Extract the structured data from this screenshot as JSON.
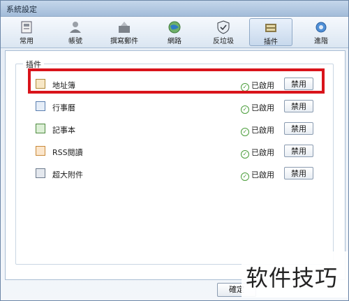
{
  "window": {
    "title": "系統設定"
  },
  "toolbar": {
    "items": [
      {
        "label": "常用",
        "icon": "settings-panel-icon",
        "active": false
      },
      {
        "label": "帳號",
        "icon": "user-icon",
        "active": false
      },
      {
        "label": "撰寫郵件",
        "icon": "compose-icon",
        "active": false
      },
      {
        "label": "網路",
        "icon": "globe-icon",
        "active": false
      },
      {
        "label": "反垃圾",
        "icon": "shield-icon",
        "active": false
      },
      {
        "label": "插件",
        "icon": "plugin-icon",
        "active": true
      },
      {
        "label": "進階",
        "icon": "gear-icon",
        "active": false
      }
    ]
  },
  "plugins": {
    "group_title": "插件",
    "items": [
      {
        "name": "地址簿",
        "status": "已啟用",
        "button": "禁用",
        "icon": "addressbook-icon"
      },
      {
        "name": "行事曆",
        "status": "已啟用",
        "button": "禁用",
        "icon": "calendar-icon"
      },
      {
        "name": "記事本",
        "status": "已啟用",
        "button": "禁用",
        "icon": "notepad-icon"
      },
      {
        "name": "RSS閱讀",
        "status": "已啟用",
        "button": "禁用",
        "icon": "rss-icon"
      },
      {
        "name": "超大附件",
        "status": "已啟用",
        "button": "禁用",
        "icon": "attachment-icon"
      }
    ]
  },
  "footer": {
    "ok_label": "確定"
  },
  "watermark": {
    "text": "软件技巧"
  },
  "colors": {
    "highlight": "#d9141b",
    "accent": "#8ea8c6",
    "status_ok": "#4a9d3a"
  }
}
